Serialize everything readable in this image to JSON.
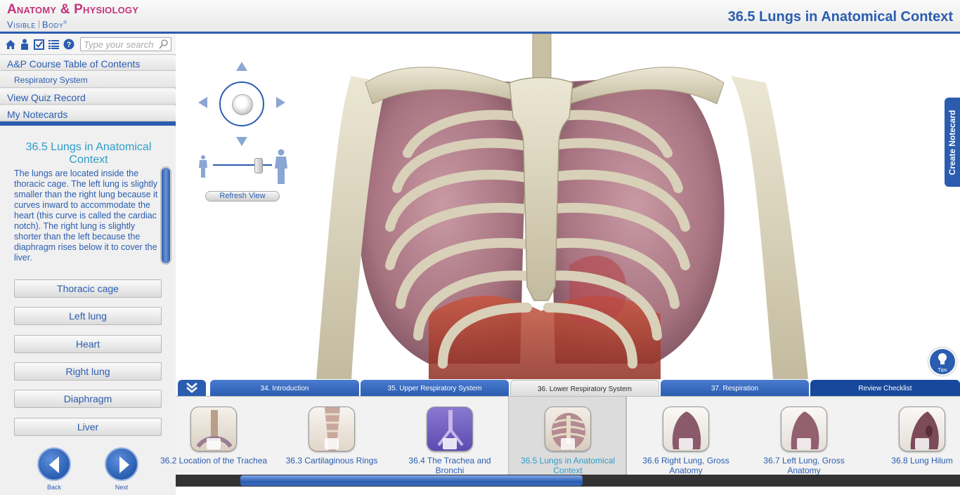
{
  "app": {
    "logo_line1": "Anatomy & Physiology",
    "logo_line2_a": "Visible",
    "logo_line2_b": "Body",
    "page_title": "36.5 Lungs in Anatomical Context",
    "accent": "#2a5db0"
  },
  "toolbar": {
    "icons": [
      "home-icon",
      "person-icon",
      "checklist-icon",
      "list-icon",
      "help-icon"
    ],
    "search_placeholder": "Type your search"
  },
  "sidebar": {
    "toc": "A&P Course Table of Contents",
    "section": "Respiratory System",
    "quiz": "View Quiz Record",
    "notecards": "My Notecards"
  },
  "content": {
    "title": "36.5 Lungs in Anatomical Context",
    "body": "The lungs are located inside the thoracic cage. The left lung is slightly smaller than the right lung because it curves inward to accommodate the heart (this curve is called the cardiac notch). The right lung is slightly shorter than the left because the diaphragm rises below it to cover the liver.",
    "structures": [
      "Thoracic cage",
      "Left lung",
      "Heart",
      "Right lung",
      "Diaphragm",
      "Liver"
    ],
    "back_label": "Back",
    "next_label": "Next"
  },
  "viewer": {
    "refresh_label": "Refresh View",
    "create_notecard": "Create Notecard",
    "tips_label": "Tips"
  },
  "tabs": [
    {
      "label": "34. Introduction"
    },
    {
      "label": "35. Upper Respiratory System"
    },
    {
      "label": "36. Lower Respiratory System"
    },
    {
      "label": "37. Respiration"
    },
    {
      "label": "Review Checklist"
    }
  ],
  "thumbnails": [
    {
      "label": "36.2 Location of the Trachea"
    },
    {
      "label": "36.3 Cartilaginous Rings"
    },
    {
      "label": "36.4 The Trachea and Bronchi"
    },
    {
      "label": "36.5 Lungs in Anatomical Context"
    },
    {
      "label": "36.6 Right Lung, Gross Anatomy"
    },
    {
      "label": "36.7 Left Lung, Gross Anatomy"
    },
    {
      "label": "36.8 Lung Hilum"
    }
  ]
}
